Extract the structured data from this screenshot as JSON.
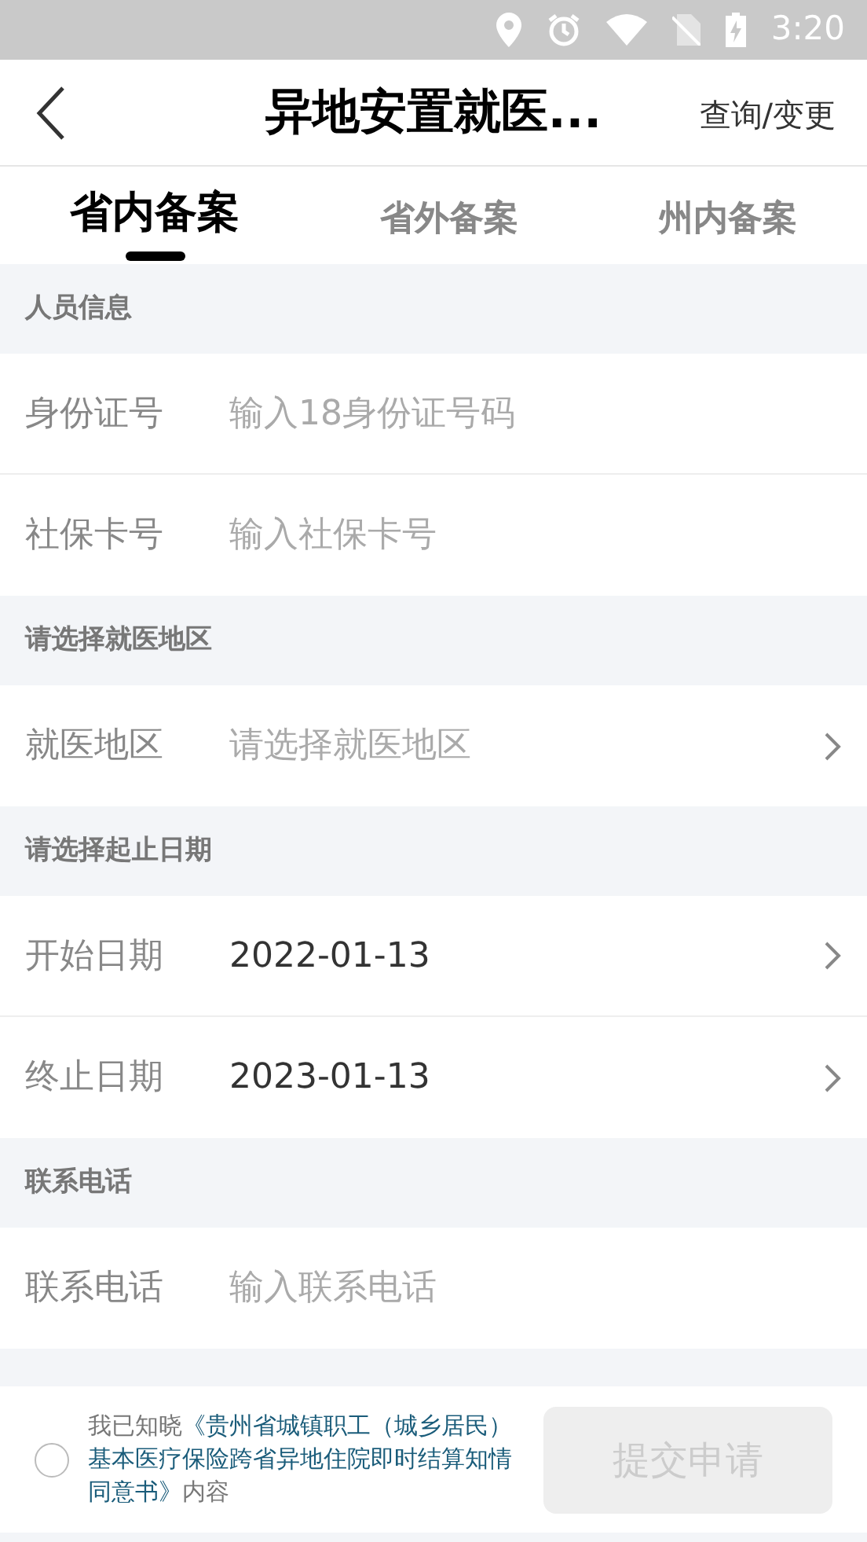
{
  "status_bar": {
    "time": "3:20"
  },
  "header": {
    "title": "异地安置就医...",
    "action": "查询/变更"
  },
  "tabs": [
    {
      "label": "省内备案",
      "selected": true
    },
    {
      "label": "省外备案",
      "selected": false
    },
    {
      "label": "州内备案",
      "selected": false
    }
  ],
  "sections": [
    {
      "title": "人员信息",
      "fields": [
        {
          "kind": "input",
          "label": "身份证号",
          "placeholder": "输入18身份证号码"
        },
        {
          "kind": "input",
          "label": "社保卡号",
          "placeholder": "输入社保卡号"
        }
      ]
    },
    {
      "title": "请选择就医地区",
      "fields": [
        {
          "kind": "select",
          "label": "就医地区",
          "placeholder": "请选择就医地区"
        }
      ]
    },
    {
      "title": "请选择起止日期",
      "fields": [
        {
          "kind": "select",
          "label": "开始日期",
          "value": "2022-01-13"
        },
        {
          "kind": "select",
          "label": "终止日期",
          "value": "2023-01-13"
        }
      ]
    },
    {
      "title": "联系电话",
      "fields": [
        {
          "kind": "input",
          "label": "联系电话",
          "placeholder": "输入联系电话"
        }
      ]
    }
  ],
  "footer": {
    "agreement": {
      "checked": false,
      "prefix": "我已知晓",
      "link": "《贵州省城镇职工（城乡居民）基本医疗保险跨省异地住院即时结算知情同意书》",
      "suffix": "内容"
    },
    "submit": {
      "label": "提交申请",
      "disabled": true
    }
  }
}
